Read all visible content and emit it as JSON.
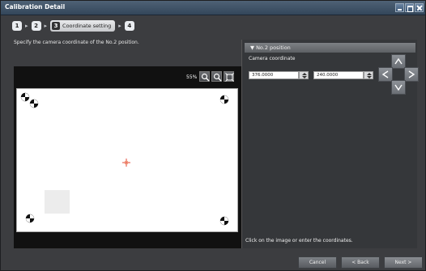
{
  "window": {
    "title": "Calibration Detail"
  },
  "steps": [
    {
      "label": "1"
    },
    {
      "label": "2"
    },
    {
      "label": "3",
      "text": "Coordinate setting"
    },
    {
      "label": "4"
    }
  ],
  "instruction": "Specify the camera coordinate of the No.2 position.",
  "view": {
    "zoom": "55%"
  },
  "panel": {
    "header": "▼ No.2 position",
    "coord_label": "Camera coordinate",
    "x_value": "376.0000",
    "y_value": "240.0000"
  },
  "hint": "Click on the image or enter the coordinates.",
  "footer": {
    "cancel": "Cancel",
    "back": "< Back",
    "next": "Next >"
  },
  "colors": {
    "titlebar": "#4f6276",
    "background": "#3c3d40",
    "crosshair": "#e34a3a"
  }
}
